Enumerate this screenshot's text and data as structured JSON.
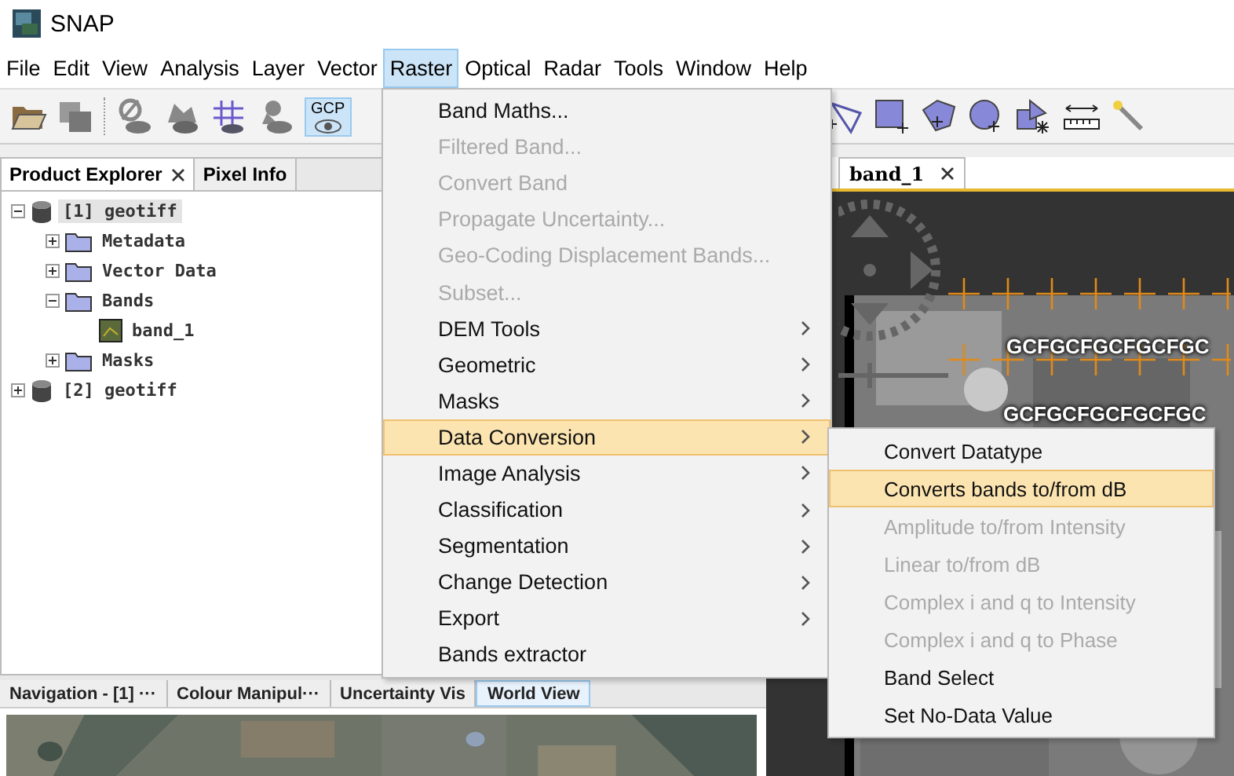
{
  "window": {
    "title": "SNAP"
  },
  "menu_bar": [
    {
      "label": "File",
      "selected": false
    },
    {
      "label": "Edit",
      "selected": false
    },
    {
      "label": "View",
      "selected": false
    },
    {
      "label": "Analysis",
      "selected": false
    },
    {
      "label": "Layer",
      "selected": false
    },
    {
      "label": "Vector",
      "selected": false
    },
    {
      "label": "Raster",
      "selected": true
    },
    {
      "label": "Optical",
      "selected": false
    },
    {
      "label": "Radar",
      "selected": false
    },
    {
      "label": "Tools",
      "selected": false
    },
    {
      "label": "Window",
      "selected": false
    },
    {
      "label": "Help",
      "selected": false
    }
  ],
  "gcp_button": {
    "label": "GCP",
    "selected": true
  },
  "explorer_tabs": [
    {
      "label": "Product Explorer",
      "selected": true
    },
    {
      "label": "Pixel Info",
      "selected": false
    }
  ],
  "tree": [
    {
      "label": "[1] geotiff",
      "kind": "product",
      "expanded": true,
      "selected": true,
      "children": [
        {
          "label": "Metadata",
          "kind": "folder",
          "expanded": false,
          "selected": false
        },
        {
          "label": "Vector Data",
          "kind": "folder",
          "expanded": false,
          "selected": false
        },
        {
          "label": "Bands",
          "kind": "folder",
          "expanded": true,
          "selected": false,
          "children": [
            {
              "label": "band_1",
              "kind": "band",
              "selected": false
            }
          ]
        },
        {
          "label": "Masks",
          "kind": "folder",
          "expanded": false,
          "selected": false
        }
      ]
    },
    {
      "label": "[2] geotiff",
      "kind": "product",
      "expanded": false,
      "selected": false
    }
  ],
  "editor_tab": {
    "label": "band_1"
  },
  "image_labels": [
    "GCFGCFGCFGCFGC",
    "GCFGCFGCFGCFGC"
  ],
  "raster_menu": [
    {
      "label": "Band Maths...",
      "disabled": false,
      "submenu": false,
      "selected": false
    },
    {
      "label": "Filtered Band...",
      "disabled": true,
      "submenu": false,
      "selected": false
    },
    {
      "label": "Convert Band",
      "disabled": true,
      "submenu": false,
      "selected": false
    },
    {
      "label": "Propagate Uncertainty...",
      "disabled": true,
      "submenu": false,
      "selected": false
    },
    {
      "label": "Geo-Coding Displacement Bands...",
      "disabled": true,
      "submenu": false,
      "selected": false
    },
    {
      "label": "Subset...",
      "disabled": true,
      "submenu": false,
      "selected": false
    },
    {
      "label": "DEM Tools",
      "disabled": false,
      "submenu": true,
      "selected": false
    },
    {
      "label": "Geometric",
      "disabled": false,
      "submenu": true,
      "selected": false
    },
    {
      "label": "Masks",
      "disabled": false,
      "submenu": true,
      "selected": false
    },
    {
      "label": "Data Conversion",
      "disabled": false,
      "submenu": true,
      "selected": true
    },
    {
      "label": "Image Analysis",
      "disabled": false,
      "submenu": true,
      "selected": false
    },
    {
      "label": "Classification",
      "disabled": false,
      "submenu": true,
      "selected": false
    },
    {
      "label": "Segmentation",
      "disabled": false,
      "submenu": true,
      "selected": false
    },
    {
      "label": "Change Detection",
      "disabled": false,
      "submenu": true,
      "selected": false
    },
    {
      "label": "Export",
      "disabled": false,
      "submenu": true,
      "selected": false
    },
    {
      "label": "Bands extractor",
      "disabled": false,
      "submenu": false,
      "selected": false
    }
  ],
  "data_conversion_submenu": [
    {
      "label": "Convert Datatype",
      "disabled": false,
      "selected": false
    },
    {
      "label": "Converts bands to/from dB",
      "disabled": false,
      "selected": true
    },
    {
      "label": "Amplitude to/from Intensity",
      "disabled": true,
      "selected": false
    },
    {
      "label": "Linear to/from dB",
      "disabled": true,
      "selected": false
    },
    {
      "label": "Complex i and q to Intensity",
      "disabled": true,
      "selected": false
    },
    {
      "label": "Complex i and q to Phase",
      "disabled": true,
      "selected": false
    },
    {
      "label": "Band Select",
      "disabled": false,
      "selected": false
    },
    {
      "label": "Set No-Data Value",
      "disabled": false,
      "selected": false
    }
  ],
  "bottom_tabs": [
    {
      "label": "Navigation - [1] ···",
      "selected": false
    },
    {
      "label": "Colour Manipul···",
      "selected": false
    },
    {
      "label": "Uncertainty Vis",
      "selected": false
    },
    {
      "label": "World View",
      "selected": true
    }
  ]
}
